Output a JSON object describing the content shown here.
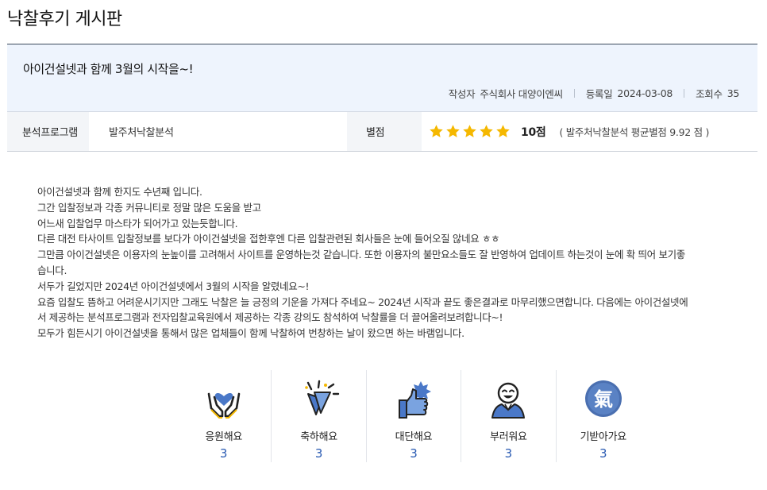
{
  "page": {
    "title": "낙찰후기 게시판"
  },
  "post": {
    "title": "아이건설넷과 함께 3월의 시작을~!",
    "meta": {
      "author_label": "작성자",
      "author": "주식회사 대양이엔씨",
      "date_label": "등록일",
      "date": "2024-03-08",
      "views_label": "조회수",
      "views": "35"
    }
  },
  "info": {
    "program_label": "분석프로그램",
    "program_value": "발주처낙찰분석",
    "rating_label": "별점",
    "stars": 5,
    "star_color": "#f5b800",
    "score": "10점",
    "average": "( 발주처낙찰분석 평균별점 9.92 점 )"
  },
  "content": {
    "lines": [
      "아이건설넷과 함께 한지도 수년째 입니다.",
      "그간 입찰정보과 각종 커뮤니티로 정말 많은 도움을 받고",
      "어느새 입찰업무 마스타가 되어가고 있는듯합니다.",
      "다른 대전 타사이트 입찰정보를 보다가 아이건설넷을 접한후엔 다른 입찰관련된 회사들은 눈에 들어오질 않네요 ㅎㅎ",
      "그만큼 아이건설넷은 이용자의 눈높이를 고려해서 사이트를 운영하는것 같습니다. 또한 이용자의 불만요소들도 잘 반영하여 업데이트 하는것이 눈에 확 띄어 보기좋",
      "습니다.",
      "서두가 길었지만 2024년 아이건설넷에서 3월의 시작을 알렸네요~!",
      "요즘 입찰도 뜸하고 어려운시기지만 그래도 낙찰은 늘 긍정의 기운을 가져다 주네요~ 2024년 시작과 끝도 좋은결과로 마무리했으면합니다. 다음에는 아이건설넷에",
      "서 제공하는 분석프로그램과 전자입찰교육원에서 제공하는 각종 강의도 참석하여 낙찰률을 더 끌어올려보려합니다~!",
      "모두가 힘든시기 아이건설넷을 통해서 많은 업체들이 함께 낙찰하여 번창하는 날이 왔으면 하는 바램입니다."
    ]
  },
  "reactions": [
    {
      "icon": "cheer-hands-heart-icon",
      "label": "응원해요",
      "count": "3"
    },
    {
      "icon": "celebrate-party-icon",
      "label": "축하해요",
      "count": "3"
    },
    {
      "icon": "thumbs-up-icon",
      "label": "대단해요",
      "count": "3"
    },
    {
      "icon": "envy-person-icon",
      "label": "부러워요",
      "count": "3"
    },
    {
      "icon": "energy-gi-icon",
      "label": "기받아가요",
      "count": "3",
      "icon_char": "氣"
    }
  ],
  "colors": {
    "accent_blue": "#2a5bb3",
    "header_bg": "#eef4fd",
    "icon_blue": "#4a78c8"
  }
}
